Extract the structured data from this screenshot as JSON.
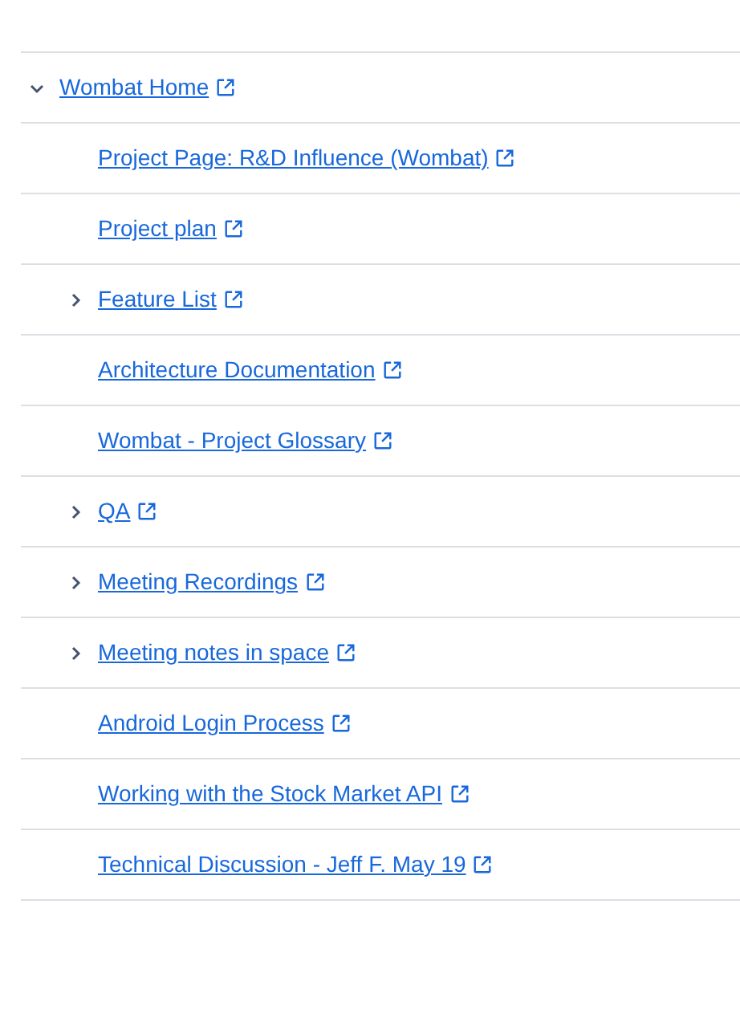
{
  "tree": [
    {
      "title": "Wombat Home",
      "expanded": true,
      "children": [
        {
          "title": "Project Page: R&D Influence (Wombat)"
        },
        {
          "title": "Project plan"
        },
        {
          "title": "Feature List",
          "expanded": false
        },
        {
          "title": "Architecture Documentation"
        },
        {
          "title": "Wombat - Project Glossary"
        },
        {
          "title": "QA",
          "expanded": false
        },
        {
          "title": "Meeting Recordings",
          "expanded": false
        },
        {
          "title": "Meeting notes in space",
          "expanded": false
        },
        {
          "title": "Android Login Process"
        },
        {
          "title": "Working with the Stock Market API"
        },
        {
          "title": "Technical Discussion - Jeff F. May 19"
        }
      ]
    }
  ]
}
